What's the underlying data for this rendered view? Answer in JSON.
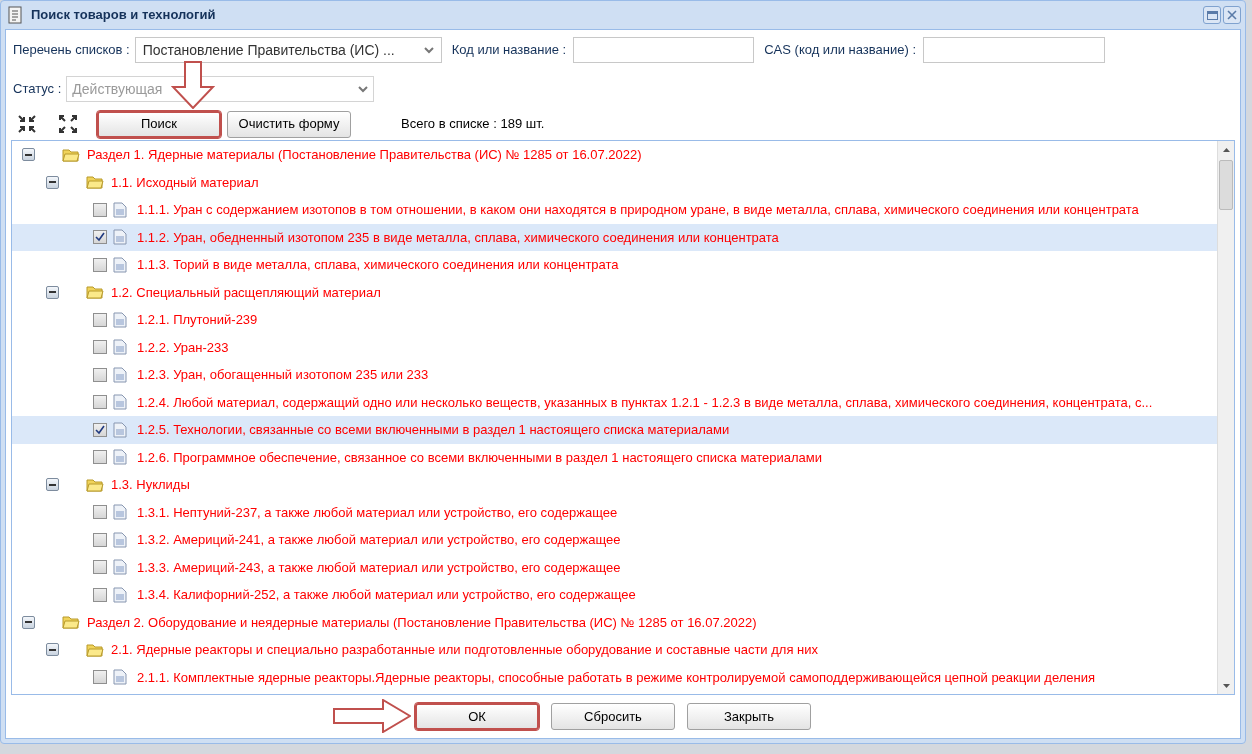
{
  "window": {
    "title": "Поиск товаров и технологий"
  },
  "filters": [
    {
      "kind": "select",
      "label": "Перечень списков :",
      "value": "Постановление Правительства (ИС) ...",
      "disabled": false
    },
    {
      "kind": "input",
      "label": "Код или название :"
    },
    {
      "kind": "input",
      "label": "CAS (код или название) :"
    }
  ],
  "status": {
    "label": "Статус :",
    "value": "Действующая",
    "disabled": true
  },
  "toolbar": {
    "buttons": [
      {
        "label": "Поиск",
        "annotated": true,
        "annotation_arrow": true
      },
      {
        "label": "Очистить форму",
        "annotated": false
      }
    ],
    "count": "Всего в списке : 189 шт."
  },
  "tree": [
    {
      "kind": "folder",
      "label": "Раздел 1. Ядерные материалы (Постановление Правительства (ИС) № 1285 от 16.07.2022)",
      "expanded": true,
      "children": [
        {
          "kind": "folder",
          "label": "1.1. Исходный материал",
          "expanded": true,
          "children": [
            {
              "kind": "leaf",
              "label": "1.1.1. Уран с содержанием изотопов в том отношении, в каком они находятся в природном уране, в виде металла, сплава, химического соединения или концентрата",
              "checked": false,
              "selected": false
            },
            {
              "kind": "leaf",
              "label": "1.1.2. Уран, обедненный изотопом 235 в виде металла, сплава, химического соединения или концентрата",
              "checked": true,
              "selected": true
            },
            {
              "kind": "leaf",
              "label": "1.1.3. Торий в виде металла, сплава, химического соединения или концентрата",
              "checked": false,
              "selected": false
            }
          ]
        },
        {
          "kind": "folder",
          "label": "1.2. Специальный расщепляющий материал",
          "expanded": true,
          "children": [
            {
              "kind": "leaf",
              "label": "1.2.1. Плутоний-239",
              "checked": false,
              "selected": false
            },
            {
              "kind": "leaf",
              "label": "1.2.2. Уран-233",
              "checked": false,
              "selected": false
            },
            {
              "kind": "leaf",
              "label": "1.2.3. Уран, обогащенный изотопом 235 или 233",
              "checked": false,
              "selected": false
            },
            {
              "kind": "leaf",
              "label": "1.2.4. Любой материал, содержащий одно или несколько веществ, указанных в пунктах 1.2.1 - 1.2.3 в виде металла, сплава, химического соединения, концентрата, с...",
              "checked": false,
              "selected": false
            },
            {
              "kind": "leaf",
              "label": "1.2.5. Технологии, связанные со всеми включенными в раздел 1 настоящего списка материалами",
              "checked": true,
              "selected": true
            },
            {
              "kind": "leaf",
              "label": "1.2.6. Программное обеспечение, связанное со всеми включенными в раздел 1 настоящего списка материалами",
              "checked": false,
              "selected": false
            }
          ]
        },
        {
          "kind": "folder",
          "label": "1.3. Нуклиды",
          "expanded": true,
          "children": [
            {
              "kind": "leaf",
              "label": "1.3.1. Нептуний-237, а также любой материал или устройство, его содержащее",
              "checked": false,
              "selected": false
            },
            {
              "kind": "leaf",
              "label": "1.3.2. Америций-241, а также любой материал или устройство, его содержащее",
              "checked": false,
              "selected": false
            },
            {
              "kind": "leaf",
              "label": "1.3.3. Америций-243, а также любой материал или устройство, его содержащее",
              "checked": false,
              "selected": false
            },
            {
              "kind": "leaf",
              "label": "1.3.4. Калифорний-252, а также любой материал или устройство, его содержащее",
              "checked": false,
              "selected": false
            }
          ]
        }
      ]
    },
    {
      "kind": "folder",
      "label": "Раздел 2. Оборудование и неядерные материалы (Постановление Правительства (ИС) № 1285 от 16.07.2022)",
      "expanded": true,
      "children": [
        {
          "kind": "folder",
          "label": "2.1. Ядерные реакторы и специально разработанные или подготовленные оборудование и составные части для них",
          "expanded": true,
          "children": [
            {
              "kind": "leaf",
              "label": "2.1.1. Комплектные ядерные реакторы.Ядерные реакторы, способные работать в режиме контролируемой самоподдерживающейся цепной реакции деления",
              "checked": false,
              "selected": false
            }
          ]
        }
      ]
    }
  ],
  "footer_buttons": [
    {
      "label": "ОК",
      "annotated": true,
      "annotation_arrow": true
    },
    {
      "label": "Сбросить",
      "annotated": false
    },
    {
      "label": "Закрыть",
      "annotated": false
    }
  ]
}
